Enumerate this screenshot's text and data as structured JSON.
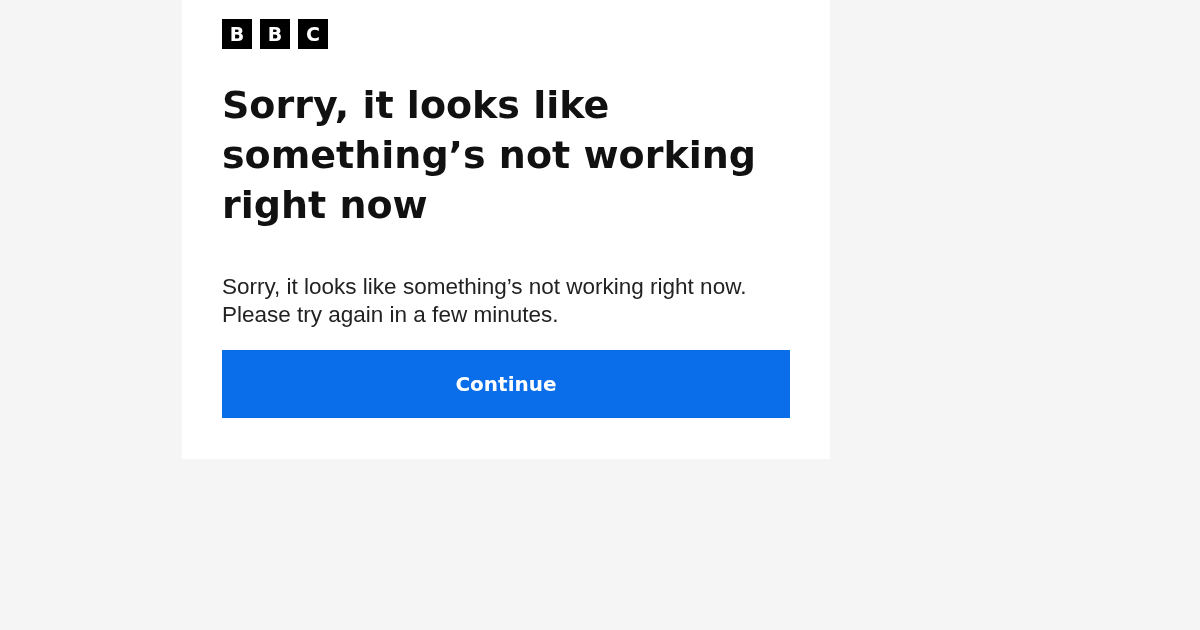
{
  "logo": {
    "letters": [
      "B",
      "B",
      "C"
    ]
  },
  "heading": "Sorry, it looks like something’s not working right now",
  "message": "Sorry, it looks like something’s not working right now. Please try again in a few minutes.",
  "button": {
    "label": "Continue"
  }
}
